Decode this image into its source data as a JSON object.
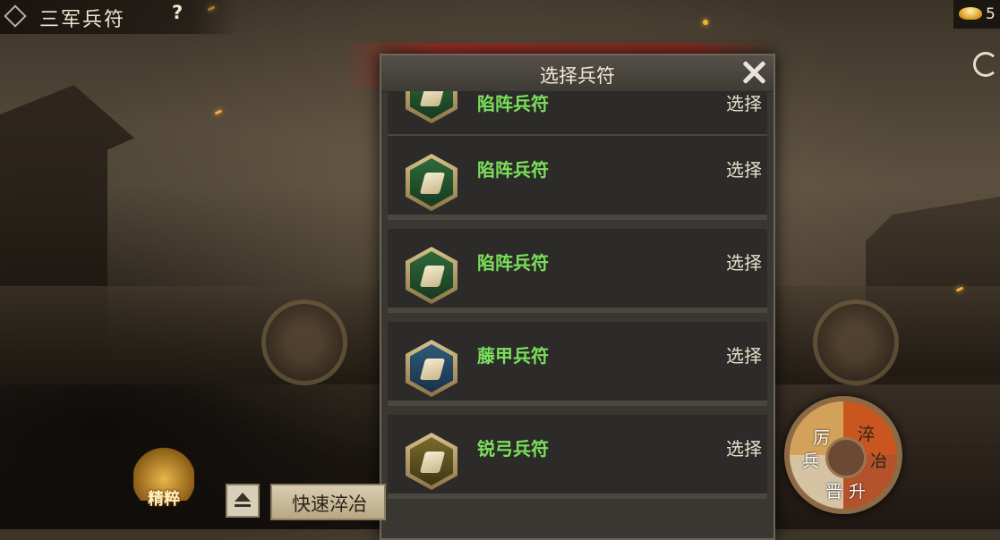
{
  "header": {
    "title": "三军兵符",
    "help": "?"
  },
  "currency": {
    "value": "5"
  },
  "modal": {
    "title": "选择兵符",
    "items": [
      {
        "name": "陷阵兵符",
        "action": "选择",
        "badge": "green"
      },
      {
        "name": "陷阵兵符",
        "action": "选择",
        "badge": "green"
      },
      {
        "name": "陷阵兵符",
        "action": "选择",
        "badge": "green"
      },
      {
        "name": "藤甲兵符",
        "action": "选择",
        "badge": "blue"
      },
      {
        "name": "锐弓兵符",
        "action": "选择",
        "badge": "gold"
      }
    ]
  },
  "bottom": {
    "elite_label": "精粹",
    "quick_label": "快速淬冶"
  },
  "wheel": {
    "top_left": "厉兵",
    "top_right": "淬冶",
    "bottom": "晋升",
    "chars": {
      "li": "厉",
      "bing": "兵",
      "cui": "淬",
      "ye": "冶",
      "jin": "晋",
      "sheng": "升"
    }
  },
  "colors": {
    "item_name": "#7be05a",
    "modal_bg": "#2c2b29"
  }
}
